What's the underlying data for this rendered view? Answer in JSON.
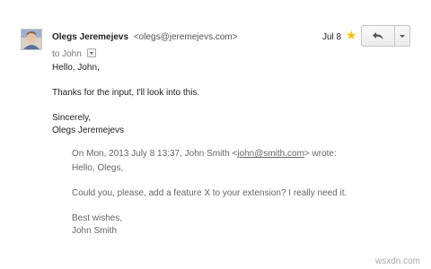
{
  "email": {
    "sender_name": "Olegs Jeremejevs",
    "sender_email": "<olegs@jeremejevs.com>",
    "to_label": "to John",
    "date": "Jul 8",
    "body": {
      "greeting": "Hello, John,",
      "message": "Thanks for the input, I'll look into this.",
      "closing": "Sincerely,",
      "signature": "Olegs Jeremejevs"
    },
    "quoted": {
      "header_prefix": "On Mon, 2013 July 8 13:37, John Smith <",
      "header_email": "john@smith.com",
      "header_suffix": "> wrote:",
      "greeting": "Hello, Olegs,",
      "message": "Could you, please, add a feature X to your extension? I really need it.",
      "closing": "Best wishes,",
      "signature": "John Smith"
    }
  },
  "icons": {
    "star": "star-icon",
    "reply": "reply-arrow-icon",
    "more": "caret-down-icon"
  },
  "colors": {
    "star": "#f1c40f",
    "quoted_text": "#666666"
  },
  "watermark": "wsxdn.com"
}
